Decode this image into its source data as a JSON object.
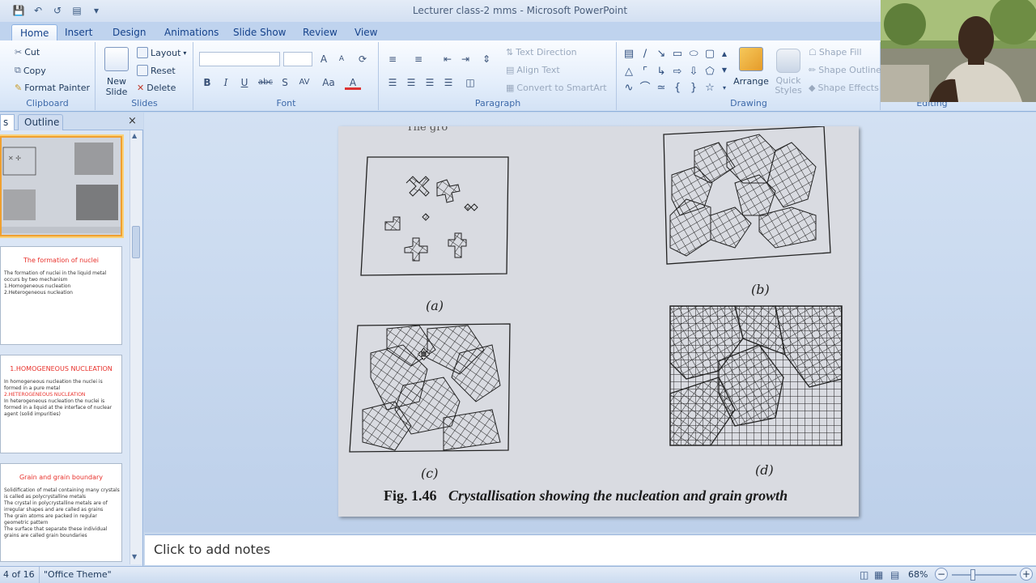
{
  "window": {
    "title": "Lecturer class-2 mms - Microsoft PowerPoint"
  },
  "tabs": [
    "Home",
    "Insert",
    "Design",
    "Animations",
    "Slide Show",
    "Review",
    "View"
  ],
  "clipboard": {
    "cut": "Cut",
    "copy": "Copy",
    "format_painter": "Format Painter",
    "label": "Clipboard"
  },
  "slides_group": {
    "new_slide": "New Slide",
    "layout": "Layout",
    "reset": "Reset",
    "delete": "Delete",
    "label": "Slides"
  },
  "font_group": {
    "label": "Font",
    "bold": "B",
    "italic": "I",
    "underline": "U",
    "strike": "abc",
    "shadow": "S",
    "spacing": "AV",
    "case": "Aa",
    "color": "A"
  },
  "paragraph_group": {
    "label": "Paragraph",
    "text_direction": "Text Direction",
    "align_text": "Align Text",
    "smartart": "Convert to SmartArt"
  },
  "drawing_group": {
    "label": "Drawing",
    "arrange": "Arrange",
    "quick_styles": "Quick Styles",
    "shape_fill": "Shape Fill",
    "shape_outline": "Shape Outline",
    "shape_effects": "Shape Effects"
  },
  "editing_group": {
    "label": "Editing"
  },
  "panel": {
    "tab_slides": "s",
    "tab_outline": "Outline",
    "close": "×"
  },
  "thumbnails": [
    {
      "title": "",
      "lines": []
    },
    {
      "title": "The formation of nuclei",
      "lines": [
        "The formation of nuclei in the liquid metal occurs by two mechanism",
        "1.Homogeneous nucleation",
        "2.Heterogeneous nucleation"
      ]
    },
    {
      "title": "1.HOMOGENEOUS NUCLEATION",
      "lines": [
        "In homogeneous nucleation the nuclei is formed in a pure metal",
        "2.HETEROGENEOUS NUCLEATION",
        "In heterogeneous nucleation the nuclei is formed in a liquid at the interface of nuclear agent (solid impurities)"
      ]
    },
    {
      "title": "Grain and grain boundary",
      "lines": [
        "Solidification of metal containing many crystals is called as polycrystalline metals",
        "The crystal in polycrystalline metals are of irregular shapes and are called as grains",
        "The grain atoms are packed in regular geometric pattern",
        "The surface that separate these individual grains are called grain boundaries"
      ]
    }
  ],
  "slide": {
    "top_text": "The gro",
    "labels": [
      "(a)",
      "(b)",
      "(c)",
      "(d)"
    ],
    "caption_fig": "Fig. 1.46",
    "caption_text": "Crystallisation showing the nucleation and grain growth"
  },
  "notes": {
    "placeholder": "Click to add notes"
  },
  "status": {
    "slide_of": "4 of 16",
    "theme": "\"Office Theme\"",
    "zoom": "68%"
  }
}
